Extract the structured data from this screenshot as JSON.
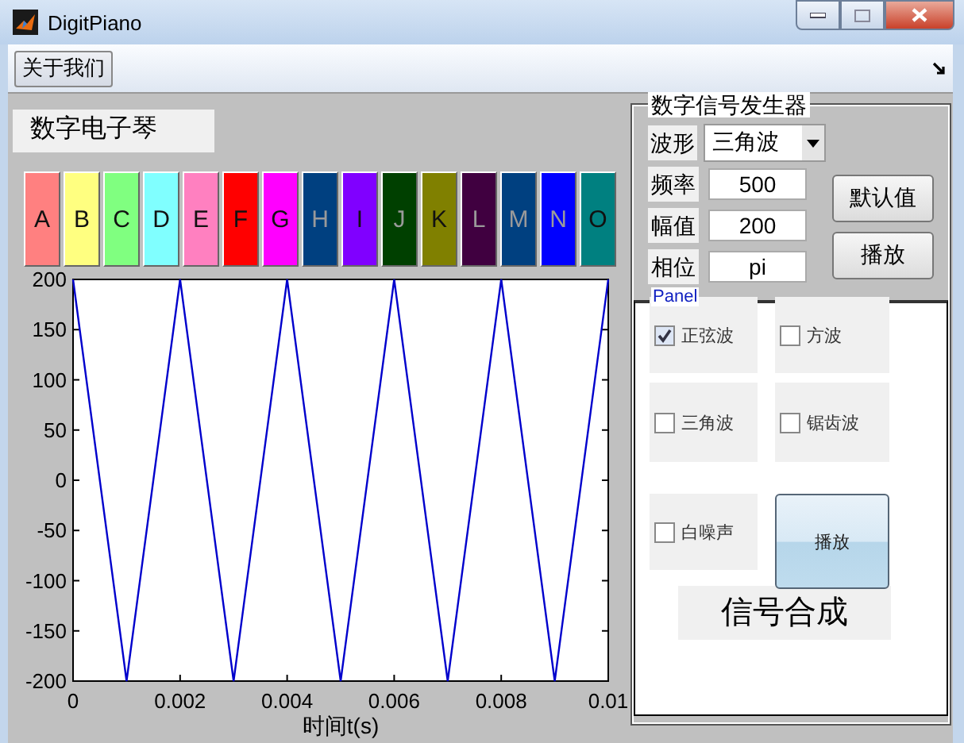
{
  "window": {
    "title": "DigitPiano"
  },
  "toolbar": {
    "buttons": [
      "关于我们"
    ]
  },
  "app_title": "数字电子琴",
  "keys": [
    {
      "label": "A",
      "color": "#ff8080"
    },
    {
      "label": "B",
      "color": "#ffff80"
    },
    {
      "label": "C",
      "color": "#80ff80"
    },
    {
      "label": "D",
      "color": "#80ffff"
    },
    {
      "label": "E",
      "color": "#ff80c0"
    },
    {
      "label": "F",
      "color": "#ff0000"
    },
    {
      "label": "G",
      "color": "#ff00ff"
    },
    {
      "label": "H",
      "color": "#004080"
    },
    {
      "label": "I",
      "color": "#8000ff"
    },
    {
      "label": "J",
      "color": "#004000"
    },
    {
      "label": "K",
      "color": "#808000"
    },
    {
      "label": "L",
      "color": "#400040"
    },
    {
      "label": "M",
      "color": "#004080"
    },
    {
      "label": "N",
      "color": "#0000ff"
    },
    {
      "label": "O",
      "color": "#008080"
    }
  ],
  "plot": {
    "chart_data": {
      "type": "line",
      "xlabel": "时间t(s)",
      "x": [
        0,
        0.001,
        0.002,
        0.003,
        0.004,
        0.005,
        0.006,
        0.007,
        0.008,
        0.009,
        0.01
      ],
      "series": [
        {
          "color": "#0000cc",
          "values": [
            200,
            -200,
            200,
            -200,
            200,
            -200,
            200,
            -200,
            200,
            -200,
            200
          ]
        }
      ],
      "xlim": [
        0,
        0.01
      ],
      "ylim": [
        -200,
        200
      ],
      "xticks": [
        0,
        0.002,
        0.004,
        0.006,
        0.008,
        0.01
      ],
      "yticks": [
        -200,
        -150,
        -100,
        -50,
        0,
        50,
        100,
        150,
        200
      ]
    }
  },
  "generator": {
    "title": "数字信号发生器",
    "waveform": {
      "label": "波形",
      "value": "三角波"
    },
    "fields": [
      {
        "label": "频率",
        "value": "500"
      },
      {
        "label": "幅值",
        "value": "200"
      },
      {
        "label": "相位",
        "value": "pi"
      }
    ],
    "buttons": [
      "默认值",
      "播放"
    ]
  },
  "panel": {
    "title": "Panel",
    "options": [
      {
        "label": "正弦波",
        "checked": true
      },
      {
        "label": "方波",
        "checked": false
      },
      {
        "label": "三角波",
        "checked": false
      },
      {
        "label": "锯齿波",
        "checked": false
      },
      {
        "label": "白噪声",
        "checked": false
      }
    ],
    "play_button": "播放"
  },
  "synth_label": "信号合成"
}
